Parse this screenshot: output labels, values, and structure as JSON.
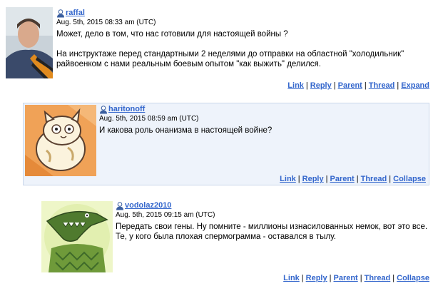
{
  "comments": [
    {
      "username": "raffal",
      "date": "Aug. 5th, 2015 08:33 am (UTC)",
      "text": "Может, дело в том, что нас готовили для настоящей войны ?\n\nНа инструктаже перед стандартными 2 неделями до отправки на областной \"холодильник\" райвоенком с нами реальным боевым опытом \"как выжить\" делился.",
      "actions": [
        "Link",
        "Reply",
        "Parent",
        "Thread",
        "Expand"
      ]
    },
    {
      "username": "haritonoff",
      "date": "Aug. 5th, 2015 08:59 am (UTC)",
      "text": "И какова роль онанизма в настоящей войне?",
      "actions": [
        "Link",
        "Reply",
        "Parent",
        "Thread",
        "Collapse"
      ]
    },
    {
      "username": "vodolaz2010",
      "date": "Aug. 5th, 2015 09:15 am (UTC)",
      "text": "Передать свои гены. Ну помните - миллионы изнасилованных немок, вот это все. Те, у кого была плохая спермограмма - оставался в тылу.",
      "actions": [
        "Link",
        "Reply",
        "Parent",
        "Thread",
        "Collapse"
      ]
    }
  ],
  "icons": {
    "user": "user-icon"
  },
  "colors": {
    "link": "#3366cc",
    "highlight_bg": "#eef3fb"
  }
}
